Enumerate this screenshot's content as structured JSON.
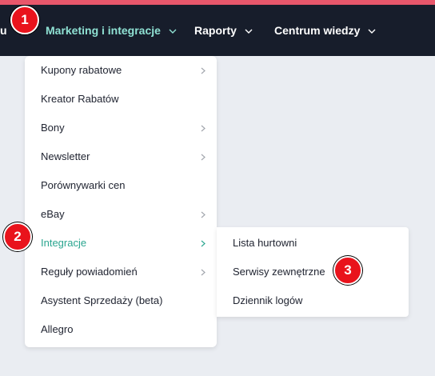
{
  "nav": {
    "partial_label": "u",
    "items": [
      {
        "label": "Marketing i integracje"
      },
      {
        "label": "Raporty"
      },
      {
        "label": "Centrum wiedzy"
      }
    ]
  },
  "menu": {
    "items": [
      {
        "label": "Kupony rabatowe"
      },
      {
        "label": "Kreator Rabatów"
      },
      {
        "label": "Bony"
      },
      {
        "label": "Newsletter"
      },
      {
        "label": "Porównywarki cen"
      },
      {
        "label": "eBay"
      },
      {
        "label": "Integracje"
      },
      {
        "label": "Reguły powiadomień"
      },
      {
        "label": "Asystent Sprzedaży (beta)"
      },
      {
        "label": "Allegro"
      }
    ]
  },
  "submenu": {
    "items": [
      {
        "label": "Lista hurtowni"
      },
      {
        "label": "Serwisy zewnętrzne"
      },
      {
        "label": "Dziennik logów"
      }
    ]
  },
  "badges": [
    "1",
    "2",
    "3"
  ],
  "colors": {
    "navbar": "#171d2b",
    "accent": "#8fe1d3",
    "active_item": "#2aa58f",
    "badge": "#e9131c",
    "top_line": "#e8576b"
  },
  "icons": {
    "nav_dropdown": "chevron-down-icon",
    "submenu_arrow": "chevron-right-icon"
  }
}
